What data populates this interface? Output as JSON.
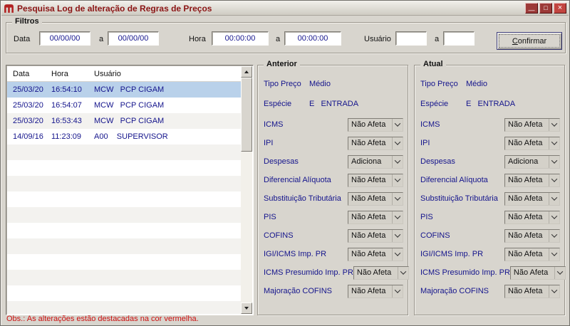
{
  "window": {
    "title": "Pesquisa Log de alteração de Regras de Preços",
    "controls": {
      "minimize_glyph": "—",
      "maximize_glyph": "□",
      "close_glyph": "×"
    }
  },
  "colors": {
    "titlebar_text": "#8b1414",
    "selected_row": "#b9d1ea",
    "field_text": "#14148c",
    "warning_text": "#cc1111",
    "window_background": "#d8d5ce"
  },
  "filters": {
    "legend": "Filtros",
    "data_label": "Data",
    "hora_label": "Hora",
    "usuario_label": "Usuário",
    "a_label": "a",
    "data_from": "00/00/00",
    "data_to": "00/00/00",
    "hora_from": "00:00:00",
    "hora_to": "00:00:00",
    "usuario_from": "",
    "usuario_to": "",
    "confirm_label": "Confirmar"
  },
  "log_table": {
    "columns": [
      "Data",
      "Hora",
      "Usuário"
    ],
    "rows": [
      {
        "data": "25/03/20",
        "hora": "16:54:10",
        "usuario": "MCW   PCP CIGAM",
        "selected": true
      },
      {
        "data": "25/03/20",
        "hora": "16:54:07",
        "usuario": "MCW   PCP CIGAM",
        "selected": false
      },
      {
        "data": "25/03/20",
        "hora": "16:53:43",
        "usuario": "MCW   PCP CIGAM",
        "selected": false
      },
      {
        "data": "14/09/16",
        "hora": "11:23:09",
        "usuario": "A00    SUPERVISOR",
        "selected": false
      }
    ]
  },
  "panels": [
    {
      "legend": "Anterior",
      "tipo_preco_label": "Tipo Preço",
      "tipo_preco_value": "Médio",
      "especie_label": "Espécie",
      "especie_value": "E   ENTRADA",
      "fields": [
        {
          "label": "ICMS",
          "value": "Não Afeta"
        },
        {
          "label": "IPI",
          "value": "Não Afeta"
        },
        {
          "label": "Despesas",
          "value": "Adiciona"
        },
        {
          "label": "Diferencial Alíquota",
          "value": "Não Afeta"
        },
        {
          "label": "Substituição Tributária",
          "value": "Não Afeta"
        },
        {
          "label": "PIS",
          "value": "Não Afeta"
        },
        {
          "label": "COFINS",
          "value": "Não Afeta"
        },
        {
          "label": "IGI/ICMS Imp. PR",
          "value": "Não Afeta"
        },
        {
          "label": "ICMS Presumido Imp. PR",
          "value": "Não Afeta"
        },
        {
          "label": "Majoração COFINS",
          "value": "Não Afeta"
        }
      ]
    },
    {
      "legend": "Atual",
      "tipo_preco_label": "Tipo Preço",
      "tipo_preco_value": "Médio",
      "especie_label": "Espécie",
      "especie_value": "E   ENTRADA",
      "fields": [
        {
          "label": "ICMS",
          "value": "Não Afeta"
        },
        {
          "label": "IPI",
          "value": "Não Afeta"
        },
        {
          "label": "Despesas",
          "value": "Adiciona"
        },
        {
          "label": "Diferencial Alíquota",
          "value": "Não Afeta"
        },
        {
          "label": "Substituição Tributária",
          "value": "Não Afeta"
        },
        {
          "label": "PIS",
          "value": "Não Afeta"
        },
        {
          "label": "COFINS",
          "value": "Não Afeta"
        },
        {
          "label": "IGI/ICMS Imp. PR",
          "value": "Não Afeta"
        },
        {
          "label": "ICMS Presumido Imp. PR",
          "value": "Não Afeta"
        },
        {
          "label": "Majoração COFINS",
          "value": "Não Afeta"
        }
      ]
    }
  ],
  "footer": {
    "obs": "Obs.: As alterações estão destacadas na cor vermelha."
  }
}
